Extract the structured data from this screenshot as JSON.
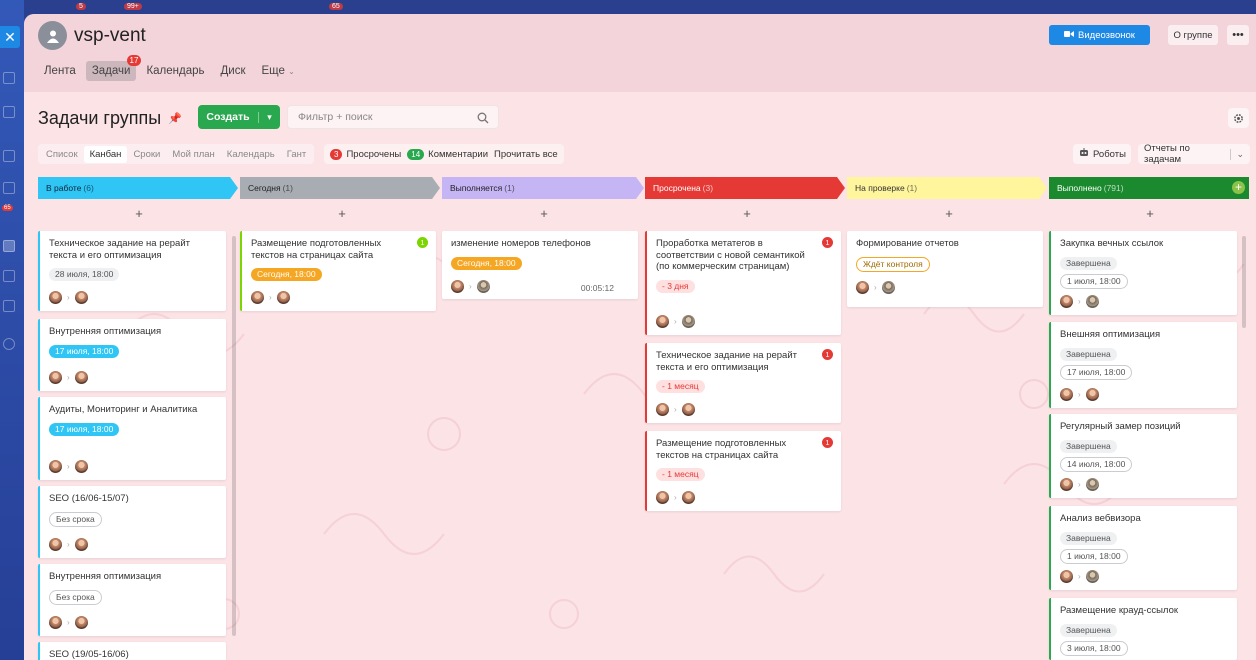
{
  "app": {
    "group_title": "vsp-vent",
    "top_badges": [
      "5",
      "99+",
      "65"
    ],
    "rail_badge": "65"
  },
  "nav": [
    {
      "label": "Лента"
    },
    {
      "label": "Задачи",
      "badge": "17"
    },
    {
      "label": "Календарь"
    },
    {
      "label": "Диск"
    },
    {
      "label": "Еще"
    }
  ],
  "header_buttons": {
    "video": "Видеозвонок",
    "about": "О группе",
    "more": "•••"
  },
  "page": {
    "title": "Задачи группы",
    "create": "Создать",
    "filter_placeholder": "Фильтр + поиск"
  },
  "views": [
    "Список",
    "Канбан",
    "Сроки",
    "Мой план",
    "Календарь",
    "Гант"
  ],
  "counters": {
    "overdue_count": "3",
    "overdue_label": "Просрочены",
    "comments_count": "14",
    "comments_label": "Комментарии",
    "read_all": "Прочитать все"
  },
  "tools": {
    "robots": "Роботы",
    "reports": "Отчеты по задачам"
  },
  "colors": {
    "in_work": "#2fc6f6",
    "today": "#a8adb4",
    "doing": "#c5b5f5",
    "overdue": "#e53935",
    "review": "#fff59d",
    "done": "#1b8a2e"
  },
  "columns": [
    {
      "title": "В работе",
      "count": "(6)",
      "cards": [
        {
          "title": "Техническое задание на рерайт текста и его оптимизация",
          "date": "28 июля, 18:00"
        },
        {
          "title": "Внутренняя оптимизация",
          "date": "17 июля, 18:00"
        },
        {
          "title": "Аудиты, Мониторинг и Аналитика",
          "date": "17 июля, 18:00"
        },
        {
          "title": "SEO (16/06-15/07)",
          "date": "Без срока"
        },
        {
          "title": "Внутренняя оптимизация",
          "date": "Без срока"
        },
        {
          "title": "SEO (19/05-16/06)"
        }
      ]
    },
    {
      "title": "Сегодня",
      "count": "(1)",
      "cards": [
        {
          "title": "Размещение подготовленных текстов на страницах сайта",
          "date": "Сегодня, 18:00",
          "badge": "1"
        }
      ]
    },
    {
      "title": "Выполняется",
      "count": "(1)",
      "cards": [
        {
          "title": "изменение номеров телефонов",
          "date": "Сегодня, 18:00",
          "timer": "00:05:12"
        }
      ]
    },
    {
      "title": "Просрочена",
      "count": "(3)",
      "cards": [
        {
          "title": "Проработка метатегов в соответствии с новой семантикой (по коммерческим страницам)",
          "date": "- 3 дня",
          "badge": "1"
        },
        {
          "title": "Техническое задание на рерайт текста и его оптимизация",
          "date": "- 1 месяц",
          "badge": "1"
        },
        {
          "title": "Размещение подготовленных текстов на страницах сайта",
          "date": "- 1 месяц",
          "badge": "1"
        }
      ]
    },
    {
      "title": "На проверке",
      "count": "(1)",
      "cards": [
        {
          "title": "Формирование отчетов",
          "date": "Ждёт контроля"
        }
      ]
    },
    {
      "title": "Выполнено",
      "count": "(791)",
      "cards": [
        {
          "title": "Закупка вечных ссылок",
          "status": "Завершена",
          "date": "1 июля, 18:00"
        },
        {
          "title": "Внешняя оптимизация",
          "status": "Завершена",
          "date": "17 июля, 18:00"
        },
        {
          "title": "Регулярный замер позиций",
          "status": "Завершена",
          "date": "14 июля, 18:00"
        },
        {
          "title": "Анализ вебвизора",
          "status": "Завершена",
          "date": "1 июля, 18:00"
        },
        {
          "title": "Размещение крауд-ссылок",
          "status": "Завершена",
          "date": "3 июля, 18:00"
        }
      ]
    }
  ]
}
